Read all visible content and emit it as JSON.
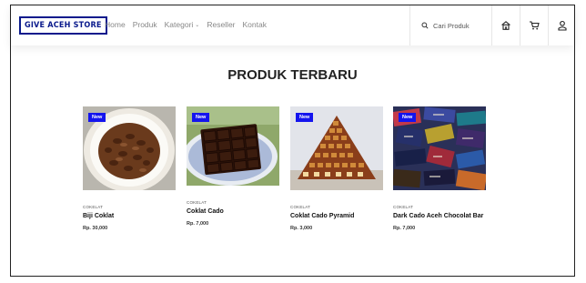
{
  "header": {
    "logo_text": "GIVE ACEH STORE",
    "nav": [
      {
        "label": "Home"
      },
      {
        "label": "Produk"
      },
      {
        "label": "Kategori"
      },
      {
        "label": "Reseller"
      },
      {
        "label": "Kontak"
      }
    ],
    "search": {
      "placeholder": "Cari Produk"
    },
    "icons": [
      "home-icon",
      "cart-icon",
      "user-icon"
    ]
  },
  "section": {
    "title": "PRODUK TERBARU"
  },
  "products": [
    {
      "badge": "New",
      "category": "COKELAT",
      "name": "Biji Coklat",
      "price": "Rp. 30,000"
    },
    {
      "badge": "New",
      "category": "COKELAT",
      "name": "Coklat Cado",
      "price": "Rp. 7,000"
    },
    {
      "badge": "New",
      "category": "COKELAT",
      "name": "Coklat Cado Pyramid",
      "price": "Rp. 3,000"
    },
    {
      "badge": "New",
      "category": "COKELAT",
      "name": "Dark Cado Aceh Chocolat Bar",
      "price": "Rp. 7,000"
    }
  ],
  "colors": {
    "brand": "#0a1a8c",
    "badge": "#1414ee",
    "nav_text": "#888888"
  }
}
